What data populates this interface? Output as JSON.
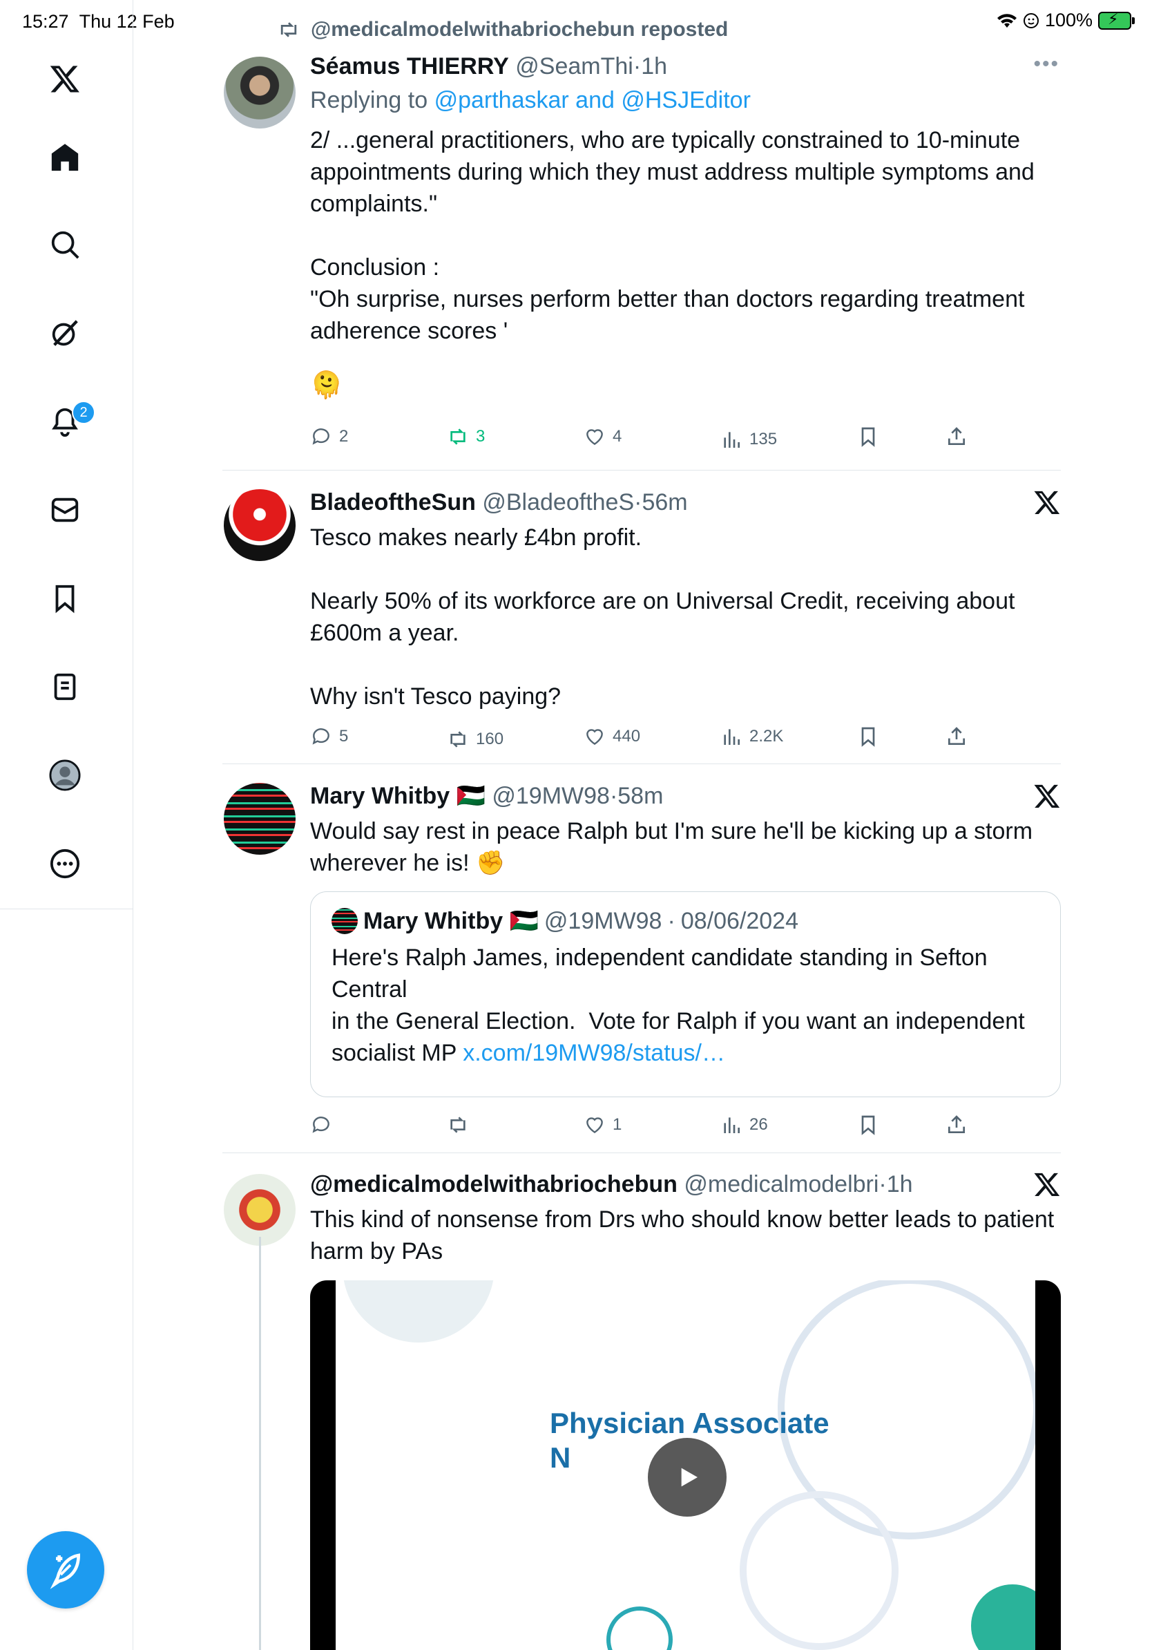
{
  "status_bar": {
    "time": "15:27",
    "date": "Thu 12 Feb",
    "battery": "100%"
  },
  "sidebar": {
    "items": [
      {
        "name": "home"
      },
      {
        "name": "search"
      },
      {
        "name": "grok"
      },
      {
        "name": "notifications",
        "badge": "2"
      },
      {
        "name": "messages"
      },
      {
        "name": "bookmarks"
      },
      {
        "name": "lists"
      },
      {
        "name": "profile"
      },
      {
        "name": "more"
      }
    ]
  },
  "tweets": [
    {
      "repost_label": "@medicalmodelwithabriochebun reposted",
      "name": "Séamus THIERRY",
      "handle": "@SeamThi",
      "dot": "·",
      "time": "1h",
      "replying_prefix": "Replying to",
      "replying_to": "@parthaskar and @HSJEditor",
      "text": "2/ ...general practitioners, who are typically constrained to 10-minute appointments during which they must address multiple symptoms and complaints.\"\n\nConclusion :\n\"Oh surprise, nurses perform better than doctors regarding treatment adherence scores '",
      "emoji": "🫠",
      "replies": "2",
      "reposts": "3",
      "likes": "4",
      "views": "135"
    },
    {
      "name": "BladeoftheSun",
      "handle": "@BladeoftheS",
      "dot": "·",
      "time": "56m",
      "text": "Tesco makes nearly £4bn profit.\n\nNearly 50% of its workforce are on Universal Credit, receiving about £600m a year.\n\nWhy isn't Tesco paying?",
      "replies": "5",
      "reposts": "160",
      "likes": "440",
      "views": "2.2K"
    },
    {
      "name": "Mary Whitby 🇵🇸",
      "handle": "@19MW98",
      "dot": "·",
      "time": "58m",
      "text": "Would say rest in peace Ralph but I'm sure he'll be kicking up a storm wherever he is! ✊",
      "quote": {
        "name": "Mary Whitby 🇵🇸",
        "handle": "@19MW98",
        "dot": "·",
        "date": "08/06/2024",
        "text": "Here's Ralph James, independent candidate standing in Sefton Central\nin the General Election.  Vote for Ralph if you want an independent socialist MP ",
        "link": "x.com/19MW98/status/…"
      },
      "replies": "",
      "reposts": "",
      "likes": "1",
      "views": "26"
    },
    {
      "name": "@medicalmodelwithabriochebun",
      "handle": "@medicalmodelbri",
      "dot": "·",
      "time": "1h",
      "text": "This kind of nonsense from Drs who should know better leads to patient harm by PAs",
      "video_title": "Physician Associate\nN"
    }
  ]
}
